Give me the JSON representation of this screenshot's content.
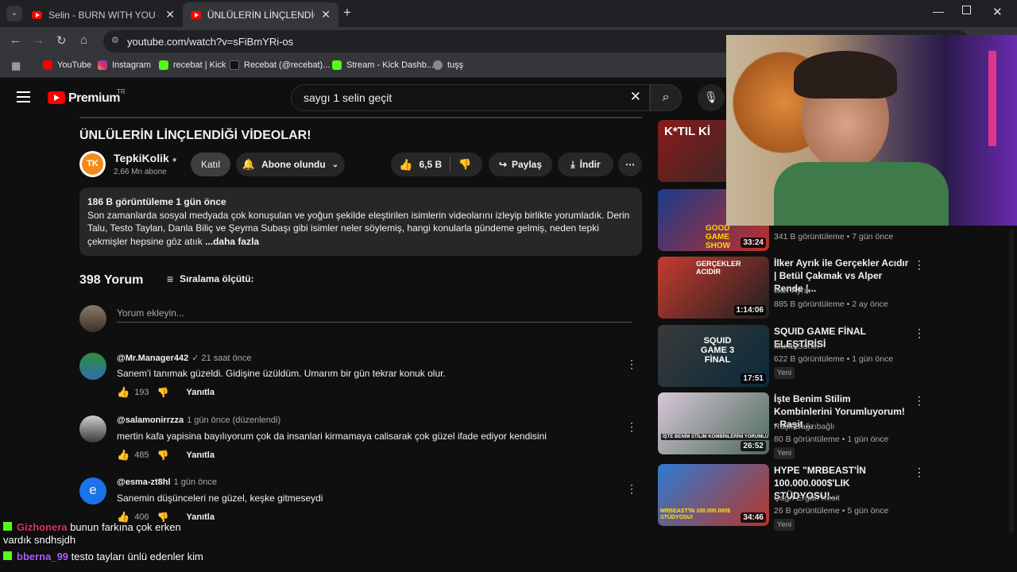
{
  "browser": {
    "tabs": [
      {
        "title": "Selin - BURN WITH YOU (Official"
      },
      {
        "title": "ÜNLÜLERİN LİNÇLENDİĞİ VİDE"
      }
    ],
    "url": "youtube.com/watch?v=sFiBmYRi-os",
    "bookmarks": [
      "YouTube",
      "Instagram",
      "recebat | Kick",
      "Recebat (@recebat)...",
      "Stream - Kick Dashb...",
      "tuşş"
    ]
  },
  "header": {
    "logo": "Premium",
    "logo_sup": "TR",
    "search_value": "saygı 1 selin geçit"
  },
  "video": {
    "title": "ÜNLÜLERİN LİNÇLENDİĞİ VİDEOLAR!",
    "channel": "TepkiKolik",
    "subs": "2,66 Mn abone",
    "join": "Katıl",
    "subscribed": "Abone olundu",
    "likes": "6,5 B",
    "share": "Paylaş",
    "download": "İndir",
    "desc_stats": "186 B görüntüleme  1 gün önce",
    "desc_text": "Son zamanlarda sosyal medyada çok konuşulan ve yoğun şekilde eleştirilen isimlerin videolarını izleyip birlikte yorumladık. Derin Talu, Testo Taylan, Danla Biliç ve Şeyma Subaşı gibi isimler neler söylemiş, hangi konularla gündeme gelmiş, neden tepki çekmişler hepsine göz atıık",
    "desc_more": "...daha fazla"
  },
  "comments_section": {
    "count": "398 Yorum",
    "sort": "Sıralama ölçütü:",
    "add_placeholder": "Yorum ekleyin..."
  },
  "comments": [
    {
      "author": "@Mr.Manager442",
      "time": "✓ 21 saat önce",
      "text": "Sanem'i tanımak güzeldi. Gidişine üzüldüm. Umarım bir gün tekrar konuk olur.",
      "likes": "193",
      "reply": "Yanıtla"
    },
    {
      "author": "@salamonirrzza",
      "time": "1 gün önce (düzenlendi)",
      "text": "mertin kafa yapisina bayılıyorum çok da insanlari kirmamaya calisarak çok güzel ifade ediyor kendisini",
      "likes": "485",
      "reply": "Yanıtla"
    },
    {
      "author": "@esma-zt8hl",
      "time": "1 gün önce",
      "text": "Sanemin düşünceleri ne güzel, keşke gitmeseydi",
      "likes": "406",
      "reply": "Yanıtla",
      "avatar_letter": "e"
    }
  ],
  "recommended": [
    {
      "thumb_text": "K*TIL Kİ",
      "duration": ""
    },
    {
      "thumb_text": "GOOD GAME SHOW",
      "duration": "33:24",
      "views": "341 B görüntüleme • 7 gün önce"
    },
    {
      "title": "İlker Ayrık ile Gerçekler Acıdır | Betül Çakmak vs Alper Rende |...",
      "channel": "İlker Ayrık",
      "views": "885 B görüntüleme • 2 ay önce",
      "duration": "1:14:06",
      "thumb_text": "GERÇEKLER ACIDIR"
    },
    {
      "title": "SQUID GAME FİNAL ELEŞTİRİSİ",
      "channel": "Murat Soner",
      "views": "622 B görüntüleme • 1 gün önce",
      "new": "Yeni",
      "duration": "17:51",
      "thumb_text": "SQUID GAME 3 FİNAL"
    },
    {
      "title": "İşte Benim Stilim Kombinlerini Yorumluyorum! - Raşit ...",
      "channel": "Raşit Bağzıbağlı",
      "views": "80 B görüntüleme • 1 gün önce",
      "new": "Yeni",
      "duration": "26:52",
      "thumb_text": "İŞTE BENİM STİLİM KOMBİNLERİNİ YORUMLUYORUM"
    },
    {
      "title": "HYPE \"MRBEAST'İN 100.000.000$'LIK STÜDYOSU!...",
      "channel": "Çağrı Ergün Kesit",
      "views": "26 B görüntüleme • 5 gün önce",
      "new": "Yeni",
      "duration": "34:46",
      "thumb_text": "MRBEAST'İN 100.000.000$ STÜDYOSU!"
    }
  ],
  "chat": [
    {
      "user": "Gizhonera",
      "msg": "bunun farkına çok erken",
      "cont": "vardık sndhsjdh",
      "color": "#d9365a"
    },
    {
      "user": "bberna_99",
      "msg": "testo tayları ünlü edenler kim",
      "color": "#b05cff"
    }
  ]
}
